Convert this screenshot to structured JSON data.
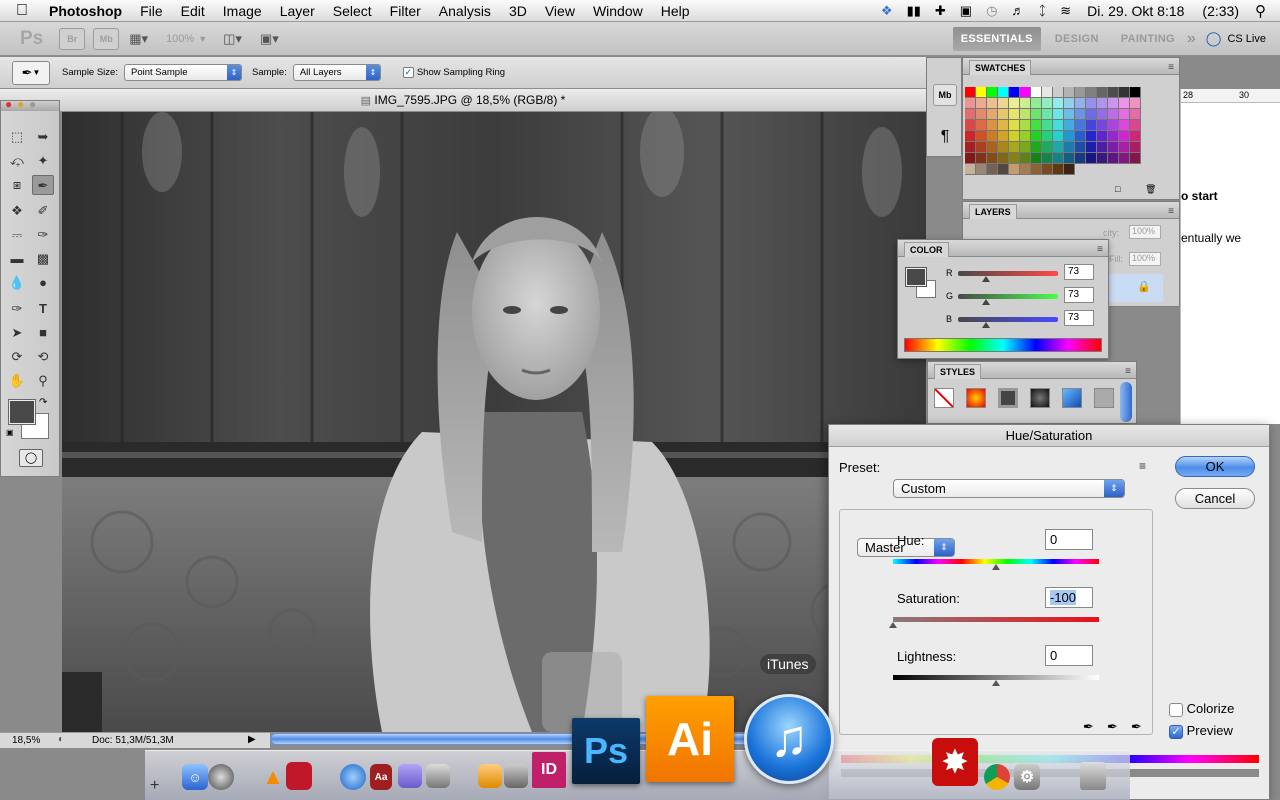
{
  "menubar": {
    "apple": "",
    "app_name": "Photoshop",
    "items": [
      "File",
      "Edit",
      "Image",
      "Layer",
      "Select",
      "Filter",
      "Analysis",
      "3D",
      "View",
      "Window",
      "Help"
    ],
    "datetime": "Di. 29. Okt  8:18",
    "battery": "(2:33)"
  },
  "appbar": {
    "ps_label": "Ps",
    "br_label": "Br",
    "mb_label": "Mb",
    "zoom": "100%",
    "workspaces": [
      "ESSENTIALS",
      "DESIGN",
      "PAINTING"
    ],
    "more": "»",
    "cs_live": "CS Live"
  },
  "options": {
    "sample_size_label": "Sample Size:",
    "sample_size_value": "Point Sample",
    "sample_label": "Sample:",
    "sample_value": "All Layers",
    "ring_label": "Show Sampling Ring",
    "ring_checked": true
  },
  "document": {
    "title": "IMG_7595.JPG @ 18,5% (RGB/8) *",
    "zoom": "18,5%",
    "doc_size": "Doc: 51,3M/51,3M"
  },
  "swatches": {
    "tab": "SWATCHES"
  },
  "layers": {
    "tab": "LAYERS",
    "opacity_label": "city:",
    "opacity": "100%",
    "fill_label": "Fill:",
    "fill": "100%"
  },
  "color": {
    "tab": "COLOR",
    "r_label": "R",
    "r": "73",
    "g_label": "G",
    "g": "73",
    "b_label": "B",
    "b": "73"
  },
  "styles": {
    "tab": "STYLES"
  },
  "background_doc": {
    "ruler_28": "28",
    "ruler_30": "30",
    "text1": "o start",
    "text2": "entually we"
  },
  "huesat": {
    "title": "Hue/Saturation",
    "preset_label": "Preset:",
    "preset_value": "Custom",
    "channel": "Master",
    "hue_label": "Hue:",
    "hue": "0",
    "saturation_label": "Saturation:",
    "saturation": "-100",
    "lightness_label": "Lightness:",
    "lightness": "0",
    "ok": "OK",
    "cancel": "Cancel",
    "colorize_label": "Colorize",
    "colorize_checked": false,
    "preview_label": "Preview",
    "preview_checked": true
  },
  "dock": {
    "tooltip": "iTunes",
    "ps_label": "Ps",
    "ai_label": "Ai",
    "id_label": "ID"
  }
}
